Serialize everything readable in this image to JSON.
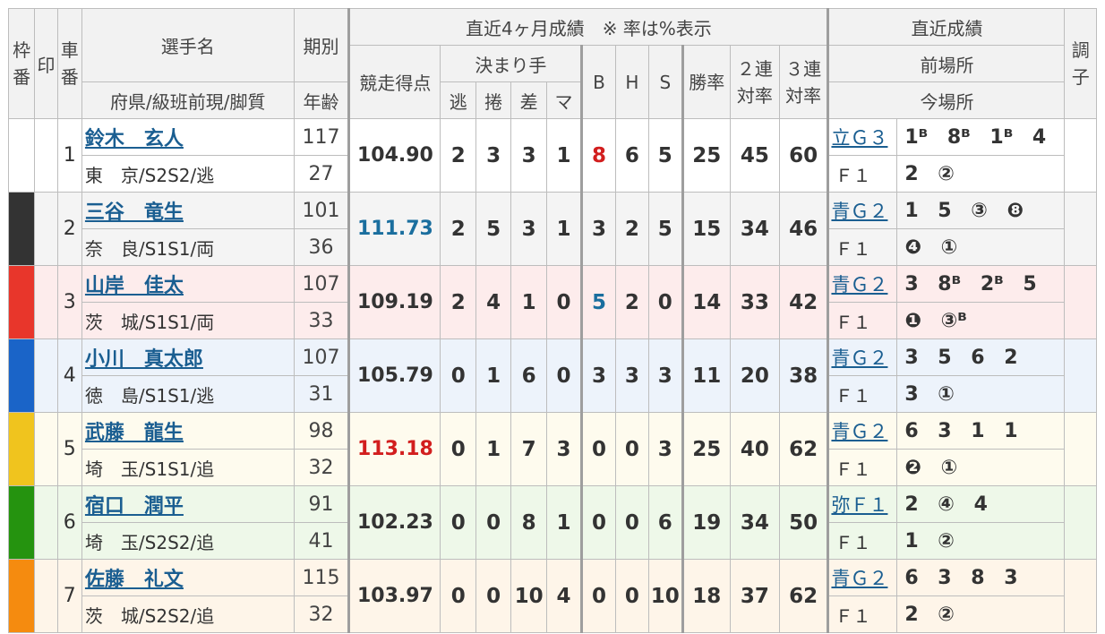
{
  "headers": {
    "waku": "枠番",
    "mark": "印",
    "car": "車番",
    "name": "選手名",
    "name_sub": "府県/級班前現/脚質",
    "term": "期別",
    "age": "年齢",
    "recent4": "直近4ヶ月成績　※ 率は%表示",
    "score": "競走得点",
    "kimarite": "決まり手",
    "nige": "逃",
    "makuri": "捲",
    "sashi": "差",
    "mark_k": "マ",
    "b": "B",
    "h": "H",
    "s": "S",
    "win": "勝率",
    "rate2": "２連対率",
    "rate3": "３連対率",
    "recent": "直近成績",
    "prev": "前場所",
    "current": "今場所",
    "condition": "調子"
  },
  "riders": [
    {
      "car": "1",
      "name": "鈴木　玄人",
      "pref": "東　京/S2S2/逃",
      "term": "117",
      "age": "27",
      "score": "104.90",
      "nige": "2",
      "makuri": "3",
      "sashi": "3",
      "mark": "1",
      "b": "8",
      "h": "6",
      "s": "5",
      "win": "25",
      "r2": "45",
      "r3": "60",
      "prev_venue": "立Ｇ３",
      "prev_res": "1ᴮ 8ᴮ 1ᴮ 4",
      "cur_venue": "Ｆ１",
      "cur_res": "2 ②"
    },
    {
      "car": "2",
      "name": "三谷　竜生",
      "pref": "奈　良/S1S1/両",
      "term": "101",
      "age": "36",
      "score": "111.73",
      "nige": "2",
      "makuri": "5",
      "sashi": "3",
      "mark": "1",
      "b": "3",
      "h": "2",
      "s": "5",
      "win": "15",
      "r2": "34",
      "r3": "46",
      "prev_venue": "青Ｇ２",
      "prev_res": "1 5 ③ ❽",
      "cur_venue": "Ｆ１",
      "cur_res": "❹ ①"
    },
    {
      "car": "3",
      "name": "山岸　佳太",
      "pref": "茨　城/S1S1/両",
      "term": "107",
      "age": "33",
      "score": "109.19",
      "nige": "2",
      "makuri": "4",
      "sashi": "1",
      "mark": "0",
      "b": "5",
      "h": "2",
      "s": "0",
      "win": "14",
      "r2": "33",
      "r3": "42",
      "prev_venue": "青Ｇ２",
      "prev_res": "3 8ᴮ 2ᴮ 5",
      "cur_venue": "Ｆ１",
      "cur_res": "❶ ③ᴮ"
    },
    {
      "car": "4",
      "name": "小川　真太郎",
      "pref": "徳　島/S1S1/逃",
      "term": "107",
      "age": "31",
      "score": "105.79",
      "nige": "0",
      "makuri": "1",
      "sashi": "6",
      "mark": "0",
      "b": "3",
      "h": "3",
      "s": "3",
      "win": "11",
      "r2": "20",
      "r3": "38",
      "prev_venue": "青Ｇ２",
      "prev_res": "3 5 6 2",
      "cur_venue": "Ｆ１",
      "cur_res": "3 ①"
    },
    {
      "car": "5",
      "name": "武藤　龍生",
      "pref": "埼　玉/S1S1/追",
      "term": "98",
      "age": "32",
      "score": "113.18",
      "nige": "0",
      "makuri": "1",
      "sashi": "7",
      "mark": "3",
      "b": "0",
      "h": "0",
      "s": "3",
      "win": "25",
      "r2": "40",
      "r3": "62",
      "prev_venue": "青Ｇ２",
      "prev_res": "6 3 1 1",
      "cur_venue": "Ｆ１",
      "cur_res": "❷ ①"
    },
    {
      "car": "6",
      "name": "宿口　潤平",
      "pref": "埼　玉/S2S2/追",
      "term": "91",
      "age": "41",
      "score": "102.23",
      "nige": "0",
      "makuri": "0",
      "sashi": "8",
      "mark": "1",
      "b": "0",
      "h": "0",
      "s": "6",
      "win": "19",
      "r2": "34",
      "r3": "50",
      "prev_venue": "弥Ｆ１",
      "prev_res": "2 ④ 4",
      "cur_venue": "Ｆ１",
      "cur_res": "1 ②"
    },
    {
      "car": "7",
      "name": "佐藤　礼文",
      "pref": "茨　城/S2S2/追",
      "term": "115",
      "age": "32",
      "score": "103.97",
      "nige": "0",
      "makuri": "0",
      "sashi": "10",
      "mark": "4",
      "b": "0",
      "h": "0",
      "s": "10",
      "win": "18",
      "r2": "37",
      "r3": "62",
      "prev_venue": "青Ｇ２",
      "prev_res": "6 3 8 3",
      "cur_venue": "Ｆ１",
      "cur_res": "2 ②"
    }
  ],
  "colors": {
    "score_max": "#d21e1e",
    "score_second": "#1a6e9e",
    "b_max": "#d21e1e",
    "b_second": "#1a6e9e",
    "link": "#1a5e91"
  }
}
